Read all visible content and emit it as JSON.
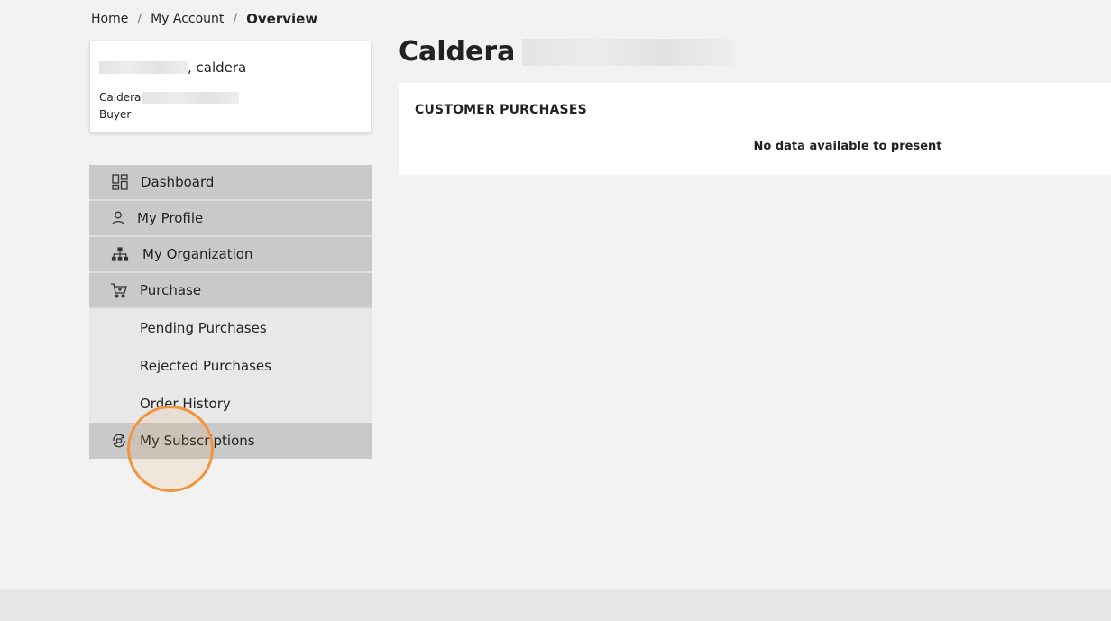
{
  "breadcrumb": {
    "home": "Home",
    "account": "My Account",
    "current": "Overview",
    "separator": "/"
  },
  "user_card": {
    "name_suffix": ", caldera",
    "company_prefix": "Caldera",
    "role": "Buyer"
  },
  "nav": {
    "dashboard": "Dashboard",
    "profile": "My Profile",
    "organization": "My Organization",
    "purchase": "Purchase",
    "pending": "Pending Purchases",
    "rejected": "Rejected Purchases",
    "history": "Order History",
    "subscriptions": "My Subscriptions"
  },
  "main": {
    "title": "Caldera",
    "panel_title": "CUSTOMER PURCHASES",
    "empty_message": "No data available to present"
  },
  "colors": {
    "accent_ring": "#f0953d",
    "nav_bg": "#c9c9c9",
    "submenu_bg": "#e8e8e8"
  }
}
